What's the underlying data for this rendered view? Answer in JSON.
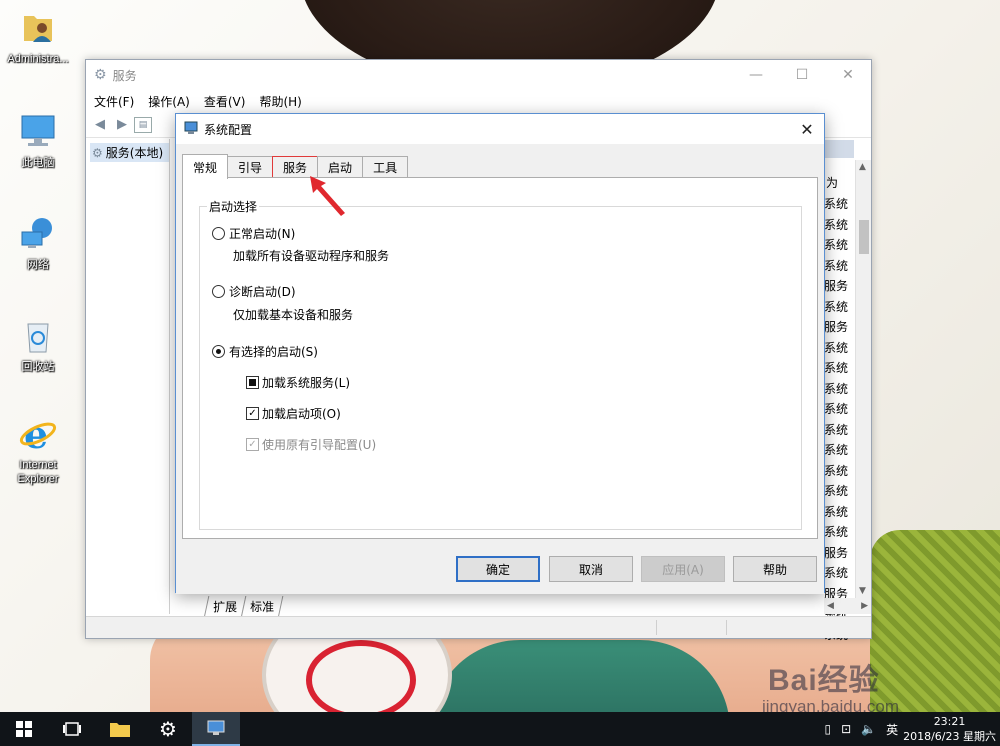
{
  "desktop": {
    "icons": [
      {
        "label": "Administra...",
        "icon": "user-folder-icon"
      },
      {
        "label": "此电脑",
        "icon": "this-pc-icon"
      },
      {
        "label": "网络",
        "icon": "network-icon"
      },
      {
        "label": "回收站",
        "icon": "recycle-bin-icon"
      },
      {
        "label": "Internet Explorer",
        "icon": "internet-explorer-icon"
      }
    ]
  },
  "services_window": {
    "title": "服务",
    "menu": [
      "文件(F)",
      "操作(A)",
      "查看(V)",
      "帮助(H)"
    ],
    "tree_node": "服务(本地)",
    "column_header_partial": "为",
    "logon_column": [
      "系统",
      "系统",
      "系统",
      "系统",
      "服务",
      "系统",
      "服务",
      "系统",
      "系统",
      "系统",
      "系统",
      "系统",
      "系统",
      "系统",
      "系统",
      "系统",
      "系统",
      "服务",
      "系统",
      "服务",
      "系统",
      "系统"
    ],
    "bottom_tabs": [
      "扩展",
      "标准"
    ]
  },
  "dialog": {
    "title": "系统配置",
    "tabs": [
      "常规",
      "引导",
      "服务",
      "启动",
      "工具"
    ],
    "active_tab": "常规",
    "highlighted_tab": "服务",
    "group_title": "启动选择",
    "options": {
      "normal": {
        "label": "正常启动(N)",
        "desc": "加载所有设备驱动程序和服务",
        "selected": false
      },
      "diagnostic": {
        "label": "诊断启动(D)",
        "desc": "仅加载基本设备和服务",
        "selected": false
      },
      "selective": {
        "label": "有选择的启动(S)",
        "selected": true
      }
    },
    "checkboxes": {
      "load_system_services": {
        "label": "加载系统服务(L)",
        "state": "indeterminate"
      },
      "load_startup_items": {
        "label": "加载启动项(O)",
        "state": "checked"
      },
      "use_original_boot": {
        "label": "使用原有引导配置(U)",
        "state": "checked-disabled"
      }
    },
    "buttons": {
      "ok": "确定",
      "cancel": "取消",
      "apply": "应用(A)",
      "help": "帮助"
    }
  },
  "watermark": {
    "brand": "Bai经验",
    "url": "jingyan.baidu.com"
  },
  "taskbar": {
    "time": "23:21",
    "date": "2018/6/23 星期六",
    "ime": "英"
  },
  "colors": {
    "dialog_border": "#5a8fd1",
    "highlight_red": "#e03a3a",
    "taskbar_bg": "#101418"
  }
}
